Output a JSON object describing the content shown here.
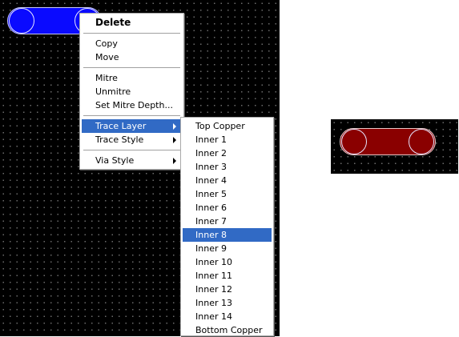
{
  "context_menu": {
    "delete": "Delete",
    "copy": "Copy",
    "move": "Move",
    "mitre": "Mitre",
    "unmitre": "Unmitre",
    "set_mitre_depth": "Set Mitre Depth...",
    "trace_layer": "Trace Layer",
    "trace_style": "Trace Style",
    "via_style": "Via Style"
  },
  "trace_layer_menu": {
    "items": [
      "Top Copper",
      "Inner 1",
      "Inner 2",
      "Inner 3",
      "Inner 4",
      "Inner 5",
      "Inner 6",
      "Inner 7",
      "Inner 8",
      "Inner 9",
      "Inner 10",
      "Inner 11",
      "Inner 12",
      "Inner 13",
      "Inner 14",
      "Bottom Copper"
    ],
    "highlighted": "Inner 8"
  },
  "colors": {
    "selected_trace": "#0a0aff",
    "preview_trace": "#8a0000",
    "menu_highlight": "#316ac5",
    "canvas": "#000000"
  }
}
